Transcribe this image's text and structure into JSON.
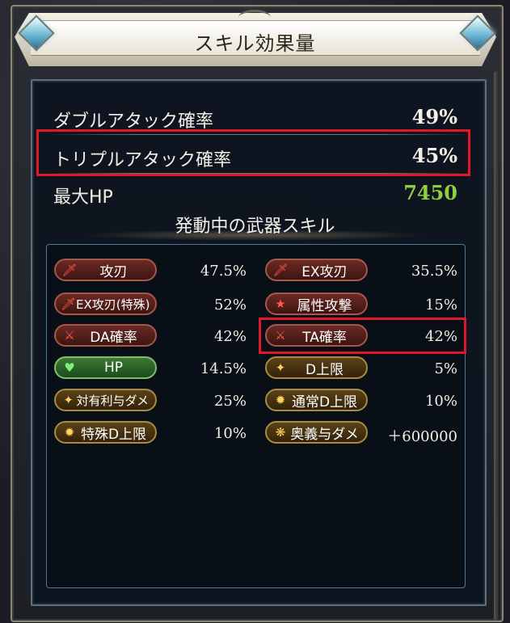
{
  "dialog": {
    "title": "スキル効果量"
  },
  "stats": [
    {
      "label": "ダブルアタック確率",
      "value": "49%"
    },
    {
      "label": "トリプルアタック確率",
      "value": "45%"
    },
    {
      "label": "最大HP",
      "value": "7450"
    }
  ],
  "skills_title": "発動中の武器スキル",
  "skills": [
    {
      "name": "攻刃",
      "value": "47.5%",
      "color": "red",
      "icon": "sword-icon"
    },
    {
      "name": "EX攻刃",
      "value": "35.5%",
      "color": "red",
      "icon": "sword-icon"
    },
    {
      "name": "EX攻刃(特殊)",
      "value": "52%",
      "color": "red",
      "icon": "sword-icon"
    },
    {
      "name": "属性攻撃",
      "value": "15%",
      "color": "red",
      "icon": "star-icon"
    },
    {
      "name": "DA確率",
      "value": "42%",
      "color": "red",
      "icon": "double-slash-icon"
    },
    {
      "name": "TA確率",
      "value": "42%",
      "color": "red",
      "icon": "triple-slash-icon"
    },
    {
      "name": "HP",
      "value": "14.5%",
      "color": "green",
      "icon": "heart-icon"
    },
    {
      "name": "D上限",
      "value": "5%",
      "color": "gold",
      "icon": "damage-cap-icon"
    },
    {
      "name": "対有利与ダメ",
      "value": "25%",
      "color": "gold",
      "icon": "advantage-damage-icon"
    },
    {
      "name": "通常D上限",
      "value": "10%",
      "color": "gold",
      "icon": "normal-cap-icon"
    },
    {
      "name": "特殊D上限",
      "value": "10%",
      "color": "gold",
      "icon": "special-cap-icon"
    },
    {
      "name": "奥義与ダメ",
      "value": "＋600000",
      "color": "gold",
      "icon": "ougi-damage-icon"
    }
  ],
  "colors": {
    "highlight": "#e0182a",
    "hp_value": "#8fd03c"
  }
}
